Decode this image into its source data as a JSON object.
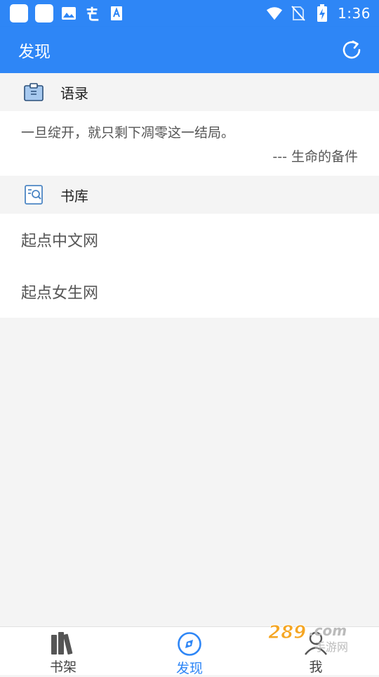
{
  "status_bar": {
    "time": "1:36",
    "icons": [
      "app-square-icon",
      "app-square-icon",
      "image-icon",
      "chinese-input-icon",
      "font-icon",
      "wifi-icon",
      "no-sim-icon",
      "battery-charging-icon"
    ]
  },
  "toolbar": {
    "title": "发现",
    "refresh_icon": "refresh-icon"
  },
  "quotes_section": {
    "title": "语录",
    "icon": "clipboard-icon",
    "quote": "一旦绽开，就只剩下凋零这一结局。",
    "source": "--- 生命的备件"
  },
  "library_section": {
    "title": "书库",
    "icon": "book-search-icon",
    "items": [
      {
        "label": "起点中文网"
      },
      {
        "label": "起点女生网"
      }
    ]
  },
  "bottom_nav": {
    "items": [
      {
        "label": "书架",
        "icon": "bookshelf-icon",
        "active": false
      },
      {
        "label": "发现",
        "icon": "compass-icon",
        "active": true
      },
      {
        "label": "我",
        "icon": "person-icon",
        "active": false
      }
    ]
  },
  "colors": {
    "primary": "#2e86f6",
    "background": "#f4f4f4",
    "card": "#ffffff",
    "text_secondary": "#555555"
  },
  "watermark": {
    "top": "289.com",
    "bottom": "手游网"
  }
}
